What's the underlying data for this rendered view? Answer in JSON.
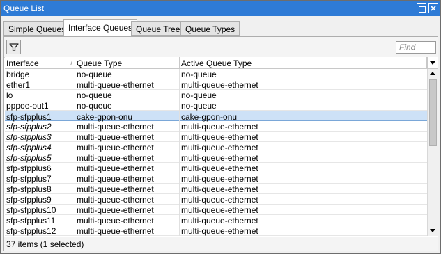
{
  "window": {
    "title": "Queue List"
  },
  "tabs": [
    {
      "label": "Simple Queues",
      "active": false
    },
    {
      "label": "Interface Queues",
      "active": true
    },
    {
      "label": "Queue Tree",
      "active": false
    },
    {
      "label": "Queue Types",
      "active": false
    }
  ],
  "toolbar": {
    "filter_icon": "filter-funnel-icon",
    "find_placeholder": "Find"
  },
  "table": {
    "columns": [
      "Interface",
      "Queue Type",
      "Active Queue Type",
      ""
    ],
    "rows": [
      {
        "interface": "bridge",
        "queue_type": "no-queue",
        "active_queue_type": "no-queue",
        "italic": false,
        "selected": false
      },
      {
        "interface": "ether1",
        "queue_type": "multi-queue-ethernet",
        "active_queue_type": "multi-queue-ethernet",
        "italic": false,
        "selected": false
      },
      {
        "interface": "lo",
        "queue_type": "no-queue",
        "active_queue_type": "no-queue",
        "italic": false,
        "selected": false
      },
      {
        "interface": "pppoe-out1",
        "queue_type": "no-queue",
        "active_queue_type": "no-queue",
        "italic": false,
        "selected": false
      },
      {
        "interface": "sfp-sfpplus1",
        "queue_type": "cake-gpon-onu",
        "active_queue_type": "cake-gpon-onu",
        "italic": false,
        "selected": true
      },
      {
        "interface": "sfp-sfpplus2",
        "queue_type": "multi-queue-ethernet",
        "active_queue_type": "multi-queue-ethernet",
        "italic": true,
        "selected": false
      },
      {
        "interface": "sfp-sfpplus3",
        "queue_type": "multi-queue-ethernet",
        "active_queue_type": "multi-queue-ethernet",
        "italic": true,
        "selected": false
      },
      {
        "interface": "sfp-sfpplus4",
        "queue_type": "multi-queue-ethernet",
        "active_queue_type": "multi-queue-ethernet",
        "italic": true,
        "selected": false
      },
      {
        "interface": "sfp-sfpplus5",
        "queue_type": "multi-queue-ethernet",
        "active_queue_type": "multi-queue-ethernet",
        "italic": true,
        "selected": false
      },
      {
        "interface": "sfp-sfpplus6",
        "queue_type": "multi-queue-ethernet",
        "active_queue_type": "multi-queue-ethernet",
        "italic": false,
        "selected": false
      },
      {
        "interface": "sfp-sfpplus7",
        "queue_type": "multi-queue-ethernet",
        "active_queue_type": "multi-queue-ethernet",
        "italic": false,
        "selected": false
      },
      {
        "interface": "sfp-sfpplus8",
        "queue_type": "multi-queue-ethernet",
        "active_queue_type": "multi-queue-ethernet",
        "italic": false,
        "selected": false
      },
      {
        "interface": "sfp-sfpplus9",
        "queue_type": "multi-queue-ethernet",
        "active_queue_type": "multi-queue-ethernet",
        "italic": false,
        "selected": false
      },
      {
        "interface": "sfp-sfpplus10",
        "queue_type": "multi-queue-ethernet",
        "active_queue_type": "multi-queue-ethernet",
        "italic": false,
        "selected": false
      },
      {
        "interface": "sfp-sfpplus11",
        "queue_type": "multi-queue-ethernet",
        "active_queue_type": "multi-queue-ethernet",
        "italic": false,
        "selected": false
      },
      {
        "interface": "sfp-sfpplus12",
        "queue_type": "multi-queue-ethernet",
        "active_queue_type": "multi-queue-ethernet",
        "italic": false,
        "selected": false
      }
    ]
  },
  "status": {
    "text": "37 items (1 selected)"
  }
}
